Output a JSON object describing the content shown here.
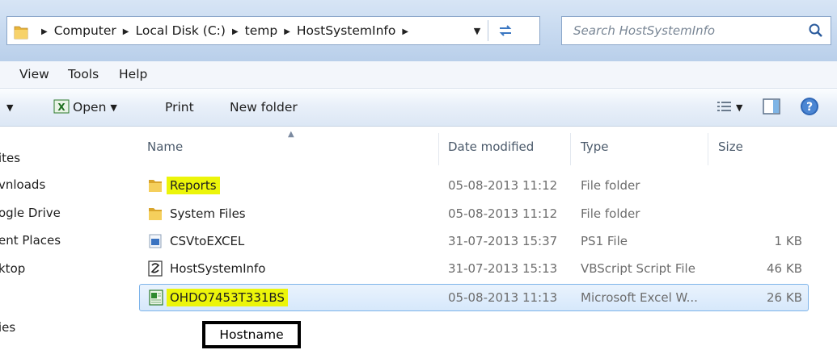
{
  "address_bar": {
    "breadcrumbs": [
      "Computer",
      "Local Disk (C:)",
      "temp",
      "HostSystemInfo"
    ],
    "search_placeholder": "Search HostSystemInfo"
  },
  "menu": {
    "items": [
      "View",
      "Tools",
      "Help"
    ]
  },
  "toolbar": {
    "open_label": "Open",
    "print_label": "Print",
    "new_folder_label": "New folder"
  },
  "nav_pane": {
    "items": [
      "ites",
      "vnloads",
      "ogle Drive",
      "ent Places",
      "ktop",
      "ies"
    ]
  },
  "columns": {
    "name": "Name",
    "date": "Date modified",
    "type": "Type",
    "size": "Size"
  },
  "files": [
    {
      "name": "Reports",
      "date": "05-08-2013 11:12",
      "type": "File folder",
      "size": "",
      "icon": "folder-icon",
      "highlighted": true
    },
    {
      "name": "System Files",
      "date": "05-08-2013 11:12",
      "type": "File folder",
      "size": "",
      "icon": "folder-icon",
      "highlighted": false
    },
    {
      "name": "CSVtoEXCEL",
      "date": "31-07-2013 15:37",
      "type": "PS1 File",
      "size": "1 KB",
      "icon": "ps1-file-icon",
      "highlighted": false
    },
    {
      "name": "HostSystemInfo",
      "date": "31-07-2013 15:13",
      "type": "VBScript Script File",
      "size": "46 KB",
      "icon": "vbscript-file-icon",
      "highlighted": false
    },
    {
      "name": "OHDO7453T331BS",
      "date": "05-08-2013 11:13",
      "type": "Microsoft Excel W...",
      "size": "26 KB",
      "icon": "excel-file-icon",
      "highlighted": true,
      "selected": true
    }
  ],
  "annotation": {
    "label": "Hostname"
  },
  "colors": {
    "highlight": "#ecf50a",
    "selection_border": "#7eb4ea",
    "chrome": "#c5d8ef"
  }
}
